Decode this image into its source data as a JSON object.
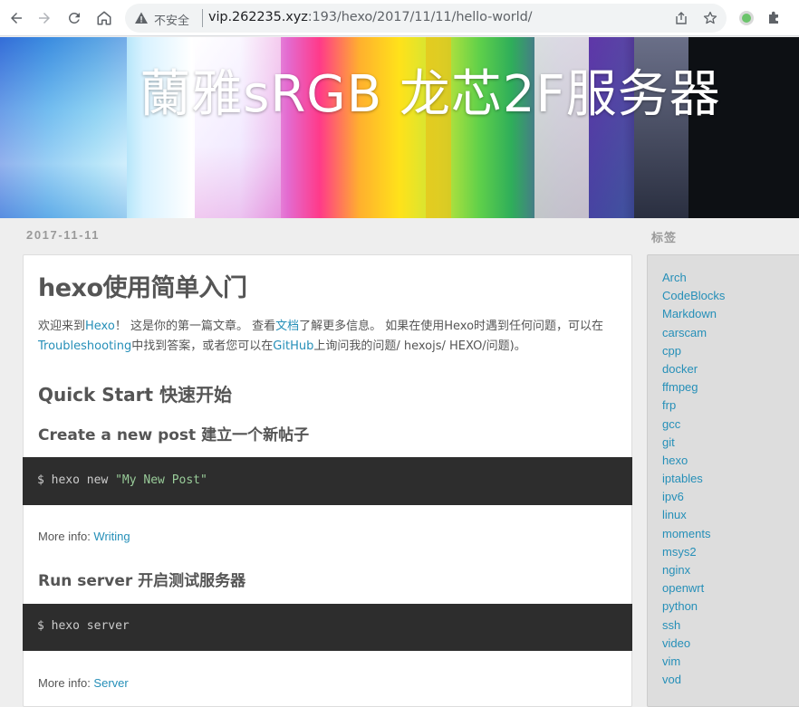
{
  "browser": {
    "insecure_label": "不安全",
    "url_host": "vip.262235.xyz",
    "url_path": ":193/hexo/2017/11/11/hello-world/"
  },
  "site": {
    "title": "蘭雅sRGB 龙芯2F服务器"
  },
  "post": {
    "date": "2017-11-11",
    "title": "hexo使用简单入门",
    "intro_1": "欢迎来到",
    "intro_link_hexo": "Hexo",
    "intro_2": "！ 这是你的第一篇文章。 查看",
    "intro_link_docs": "文档",
    "intro_3": "了解更多信息。 如果在使用Hexo时遇到任何问题，可以在",
    "intro_link_troubleshooting": "Troubleshooting",
    "intro_4": "中找到答案，或者您可以在",
    "intro_link_github": "GitHub",
    "intro_5": "上询问我的问题/ hexojs/ HEXO/问题)。",
    "h2_quickstart": "Quick Start 快速开始",
    "h3_create": "Create a new post 建立一个新帖子",
    "code1_cmd": "$ hexo new ",
    "code1_str": "\"My New Post\"",
    "more_info_label": "More info: ",
    "more_info_1_link": "Writing",
    "h3_server": "Run server 开启测试服务器",
    "code2_cmd": "$ hexo server",
    "more_info_2_link": "Server"
  },
  "sidebar": {
    "title": "标签",
    "tags": [
      "Arch",
      "CodeBlocks",
      "Markdown",
      "carscam",
      "cpp",
      "docker",
      "ffmpeg",
      "frp",
      "gcc",
      "git",
      "hexo",
      "iptables",
      "ipv6",
      "linux",
      "moments",
      "msys2",
      "nginx",
      "openwrt",
      "python",
      "ssh",
      "video",
      "vim",
      "vod"
    ]
  },
  "colors": {
    "link": "#258fb8",
    "code_bg": "#2d2d2d",
    "code_string": "#99cc99"
  }
}
